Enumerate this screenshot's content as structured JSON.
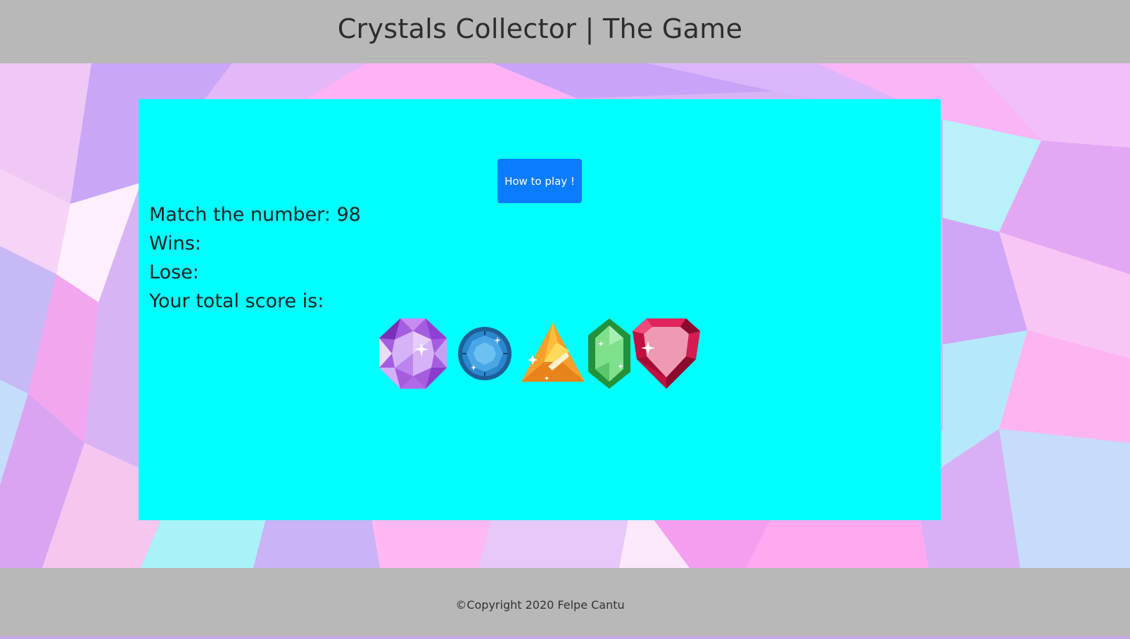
{
  "header": {
    "title": "Crystals Collector | The Game"
  },
  "game": {
    "how_to_play_label": "How to play !",
    "match_label": "Match the number:",
    "match_value": "98",
    "wins_label": "Wins:",
    "wins_value": "",
    "lose_label": "Lose:",
    "lose_value": "",
    "score_label": "Your total score is:",
    "score_value": "",
    "crystals": [
      {
        "name": "purple-octagon-gem",
        "color": "#b56ee8"
      },
      {
        "name": "blue-round-gem",
        "color": "#2b8fd6"
      },
      {
        "name": "orange-triangle-gem",
        "color": "#f5a623"
      },
      {
        "name": "green-hexagon-gem",
        "color": "#35b34a"
      },
      {
        "name": "red-heart-gem",
        "color": "#e0245e"
      }
    ]
  },
  "footer": {
    "copyright": "©Copyright 2020 Felpe Cantu"
  },
  "colors": {
    "header_bg": "#b8b8b8",
    "panel_bg": "#00ffff",
    "button_bg": "#0b7bff"
  }
}
